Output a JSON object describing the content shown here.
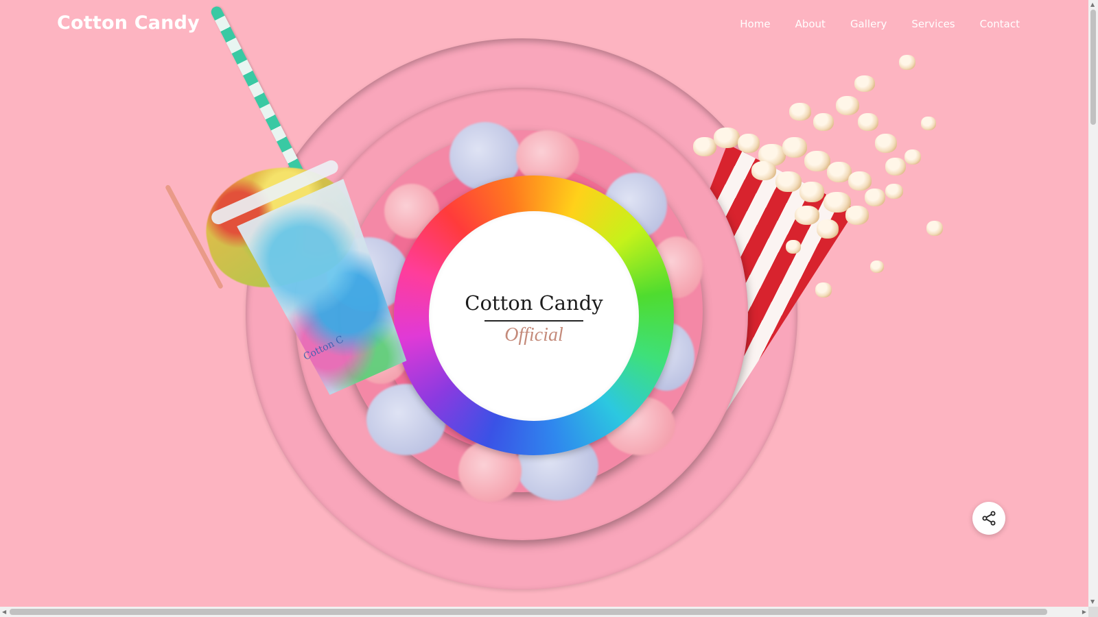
{
  "header": {
    "brand": "Cotton Candy",
    "nav": [
      "Home",
      "About",
      "Gallery",
      "Services",
      "Contact"
    ]
  },
  "hero": {
    "logo_title": "Cotton Candy",
    "logo_subtitle": "Official",
    "cup_text": "Cotton C"
  },
  "icons": {
    "share": "share-icon",
    "scroll_up": "chevron-up-icon",
    "scroll_down": "chevron-down-icon",
    "scroll_left": "chevron-left-icon",
    "scroll_right": "chevron-right-icon"
  },
  "colors": {
    "background": "#fdb4c1",
    "ring_outer": "#f9a6bb",
    "ring_inner": "#f06d94",
    "text": "#ffffff"
  }
}
